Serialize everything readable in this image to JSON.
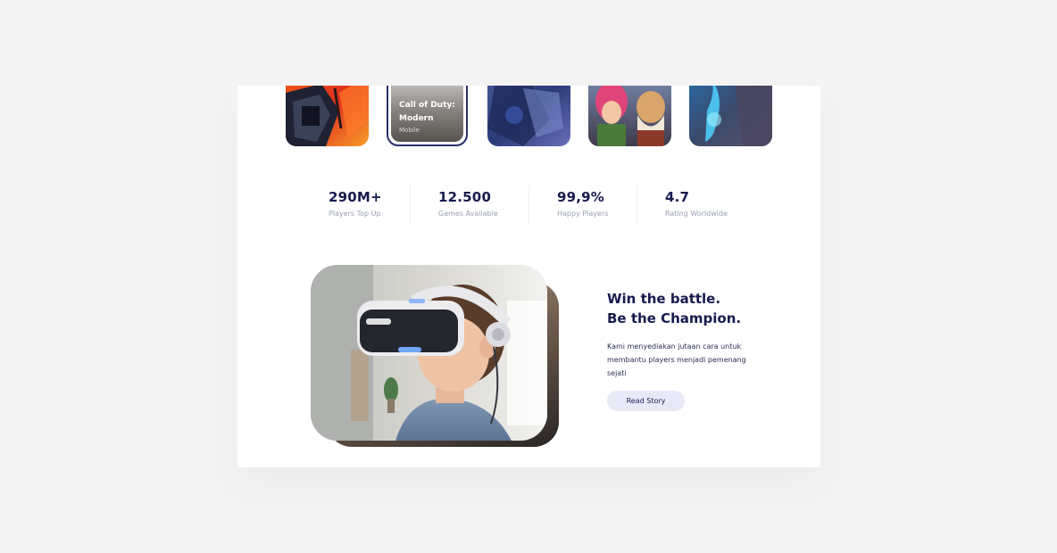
{
  "games": {
    "featured": {
      "title": "Call of Duty: Modern",
      "subtitle": "Mobile"
    }
  },
  "stats": [
    {
      "value": "290M+",
      "label": "Players Top Up"
    },
    {
      "value": "12.500",
      "label": "Games Available"
    },
    {
      "value": "99,9%",
      "label": "Happy Players"
    },
    {
      "value": "4.7",
      "label": "Rating Worldwide"
    }
  ],
  "hero": {
    "headline_line1": "Win the battle.",
    "headline_line2": "Be the Champion.",
    "description": "Kami menyediakan jutaan cara untuk membantu players menjadi pemenang sejati",
    "button_label": "Read Story"
  },
  "colors": {
    "primary_text": "#161a4d",
    "muted_text": "#9aa0b6",
    "button_bg": "#e7e9f7",
    "page_bg": "#f4f4f4"
  }
}
